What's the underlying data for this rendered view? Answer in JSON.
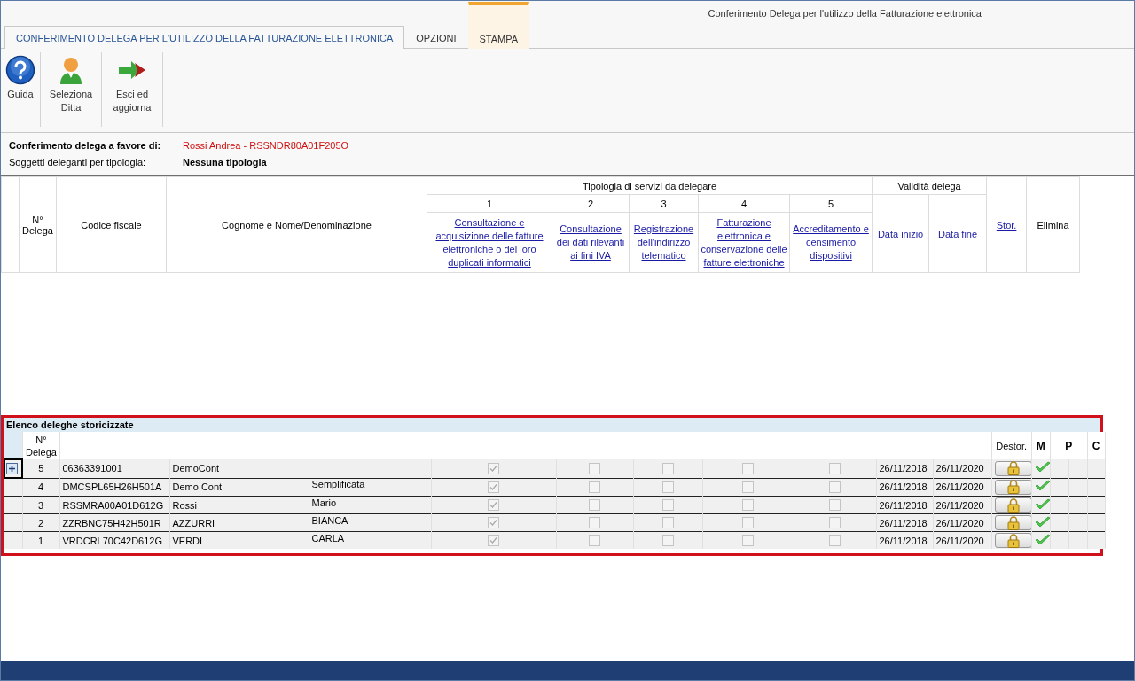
{
  "window": {
    "title": "Conferimento Delega per l'utilizzo della Fatturazione elettronica"
  },
  "tabs": [
    {
      "label": "CONFERIMENTO DELEGA PER L'UTILIZZO DELLA FATTURAZIONE ELETTRONICA",
      "selected": true,
      "contextual": false
    },
    {
      "label": "OPZIONI",
      "selected": false,
      "contextual": false
    },
    {
      "label": "STAMPA",
      "selected": false,
      "contextual": true
    }
  ],
  "ribbon": [
    {
      "kind": "help",
      "label": "Guida"
    },
    {
      "kind": "person",
      "label": "Seleziona Ditta"
    },
    {
      "kind": "exit",
      "label": "Esci ed aggiorna"
    }
  ],
  "info": [
    {
      "label": "Conferimento delega a favore di:",
      "value": "Rossi Andrea - RSSNDR80A01F205O",
      "kind": "highlight"
    },
    {
      "label": "Soggetti deleganti per tipologia:",
      "value": "Nessuna tipologia",
      "kind": "bold"
    }
  ],
  "table": {
    "number_header": "N° Delega",
    "cf_header": "Codice fiscale",
    "name_header": "Cognome e Nome/Denominazione",
    "services_header": "Tipologia di servizi da delegare",
    "services": [
      {
        "number": "1",
        "label": "Consultazione e acquisizione delle fatture elettroniche o dei loro duplicati informatici"
      },
      {
        "number": "2",
        "label": "Consultazione dei dati rilevanti ai fini IVA"
      },
      {
        "number": "3",
        "label": "Registrazione dell'indirizzo telematico"
      },
      {
        "number": "4",
        "label": "Fatturazione elettronica e conservazione delle fatture elettroniche"
      },
      {
        "number": "5",
        "label": "Accreditamento e censimento dispositivi"
      }
    ],
    "validity_header": "Validità delega",
    "start_header": "Data inizio",
    "end_header": "Data fine",
    "stor_header": "Stor.",
    "delete_header": "Elimina"
  },
  "history": {
    "title": "Elenco deleghe storicizzate",
    "number_header": "N° Delega",
    "destor_header": "Destor.",
    "m_header": "M",
    "p_header": "P",
    "c_header": "C",
    "rows": [
      {
        "expandable": true,
        "number": "5",
        "cf": "06363391001",
        "surname": "DemoCont",
        "services": [
          true,
          false,
          false,
          false,
          false
        ],
        "start": "26/11/2018",
        "end": "26/11/2020",
        "m": true
      },
      {
        "expandable": false,
        "number": "4",
        "cf": "DMCSPL65H26H501A",
        "surname": "Demo Cont",
        "name": "Semplificata",
        "services": [
          true,
          false,
          false,
          false,
          false
        ],
        "start": "26/11/2018",
        "end": "26/11/2020",
        "m": true
      },
      {
        "expandable": false,
        "number": "3",
        "cf": "RSSMRA00A01D612G",
        "surname": "Rossi",
        "name": "Mario",
        "services": [
          true,
          false,
          false,
          false,
          false
        ],
        "start": "26/11/2018",
        "end": "26/11/2020",
        "m": true
      },
      {
        "expandable": false,
        "number": "2",
        "cf": "ZZRBNC75H42H501R",
        "surname": "AZZURRI",
        "name": "BIANCA",
        "services": [
          true,
          false,
          false,
          false,
          false
        ],
        "start": "26/11/2018",
        "end": "26/11/2020",
        "m": true
      },
      {
        "expandable": false,
        "number": "1",
        "cf": "VRDCRL70C42D612G",
        "surname": "VERDI",
        "name": "CARLA",
        "services": [
          true,
          false,
          false,
          false,
          false
        ],
        "start": "26/11/2018",
        "end": "26/11/2020",
        "m": true
      }
    ]
  }
}
